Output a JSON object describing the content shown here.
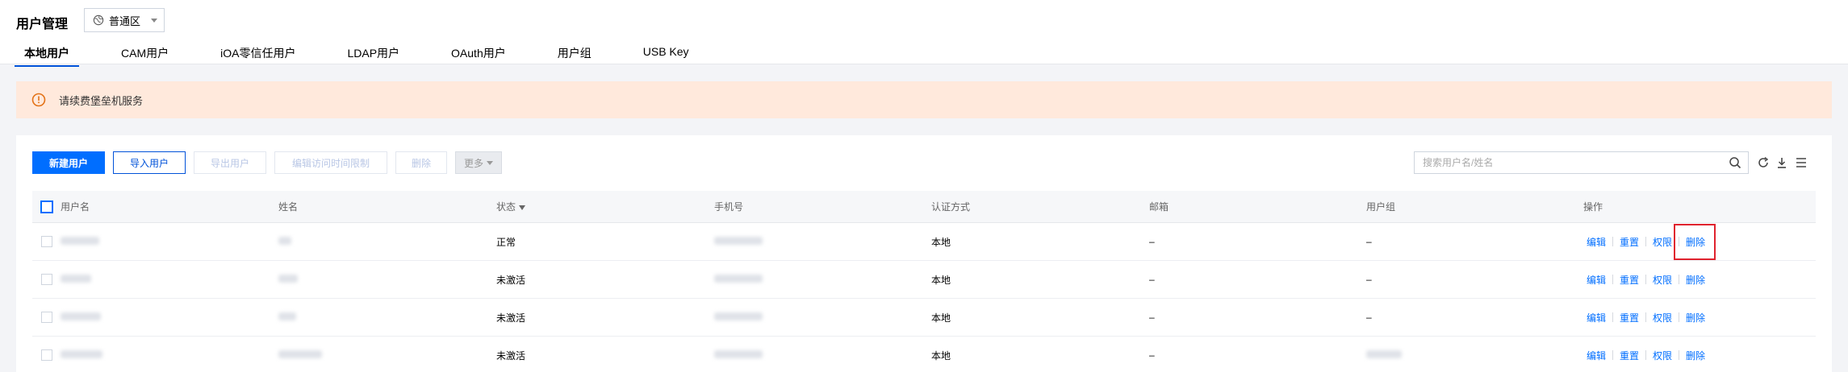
{
  "header": {
    "title": "用户管理",
    "region": "普通区"
  },
  "tabs": [
    {
      "label": "本地用户",
      "active": true
    },
    {
      "label": "CAM用户"
    },
    {
      "label": "iOA零信任用户"
    },
    {
      "label": "LDAP用户"
    },
    {
      "label": "OAuth用户"
    },
    {
      "label": "用户组"
    },
    {
      "label": "USB Key"
    }
  ],
  "banner": {
    "text": "请续费堡垒机服务",
    "bg_color": "#ffe9dc"
  },
  "toolbar": {
    "new_user": "新建用户",
    "import_user": "导入用户",
    "export_user": "导出用户",
    "edit_access_time": "编辑访问时间限制",
    "delete": "删除",
    "more": "更多"
  },
  "search": {
    "placeholder": "搜索用户名/姓名"
  },
  "table": {
    "columns": {
      "username": "用户名",
      "name": "姓名",
      "status": "状态",
      "phone": "手机号",
      "auth": "认证方式",
      "email": "邮箱",
      "group": "用户组",
      "ops": "操作"
    },
    "rows": [
      {
        "status": "正常",
        "auth": "本地",
        "email": "–",
        "group": "–"
      },
      {
        "status": "未激活",
        "auth": "本地",
        "email": "–",
        "group": "–"
      },
      {
        "status": "未激活",
        "auth": "本地",
        "email": "–",
        "group": "–"
      },
      {
        "status": "未激活",
        "auth": "本地",
        "email": "–",
        "group": ""
      }
    ],
    "actions": {
      "edit": "编辑",
      "reset": "重置",
      "perm": "权限",
      "delete": "删除"
    }
  },
  "colors": {
    "primary": "#006eff",
    "highlight": "#e0232e"
  }
}
